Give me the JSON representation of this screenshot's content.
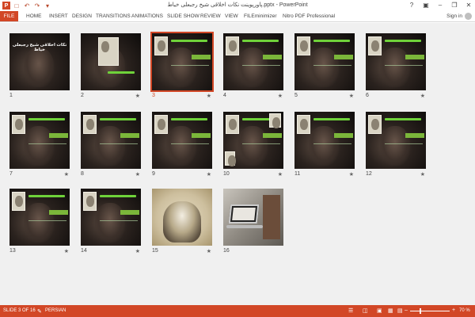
{
  "window": {
    "title": "پاورپوینت نکات اخلاقی شیخ رجبعلی خیاط.pptx - PowerPoint",
    "sign_in": "Sign in",
    "app_logo": "P"
  },
  "ribbon": {
    "tabs": [
      "FILE",
      "HOME",
      "INSERT",
      "DESIGN",
      "TRANSITIONS",
      "ANIMATIONS",
      "SLIDE SHOW",
      "REVIEW",
      "VIEW",
      "FILEminimizer",
      "Nitro PDF Professional"
    ]
  },
  "slides": [
    {
      "number": "1",
      "type": "title",
      "title": "نکات اخلاقی شیخ رجبعلی خیاط",
      "animated": false
    },
    {
      "number": "2",
      "type": "portrait",
      "animated": true
    },
    {
      "number": "3",
      "type": "dark",
      "animated": true,
      "selected": true
    },
    {
      "number": "4",
      "type": "dark",
      "animated": true
    },
    {
      "number": "5",
      "type": "dark",
      "animated": true
    },
    {
      "number": "6",
      "type": "dark",
      "animated": true
    },
    {
      "number": "7",
      "type": "dark",
      "animated": true
    },
    {
      "number": "8",
      "type": "dark",
      "animated": true
    },
    {
      "number": "9",
      "type": "dark",
      "animated": true
    },
    {
      "number": "10",
      "type": "dark",
      "animated": true
    },
    {
      "number": "11",
      "type": "dark",
      "animated": true
    },
    {
      "number": "12",
      "type": "dark",
      "animated": true
    },
    {
      "number": "13",
      "type": "dark",
      "animated": true
    },
    {
      "number": "14",
      "type": "dark",
      "animated": true
    },
    {
      "number": "15",
      "type": "sepia",
      "animated": true
    },
    {
      "number": "16",
      "type": "photo",
      "animated": false
    }
  ],
  "star_glyph": "★",
  "statusbar": {
    "slide_info": "SLIDE 3 OF 16",
    "language": "PERSIAN",
    "zoom": "70 %"
  },
  "colors": {
    "accent": "#d24726",
    "sorter_bg": "#f0f0f0",
    "green_text": "#6fd23a"
  }
}
